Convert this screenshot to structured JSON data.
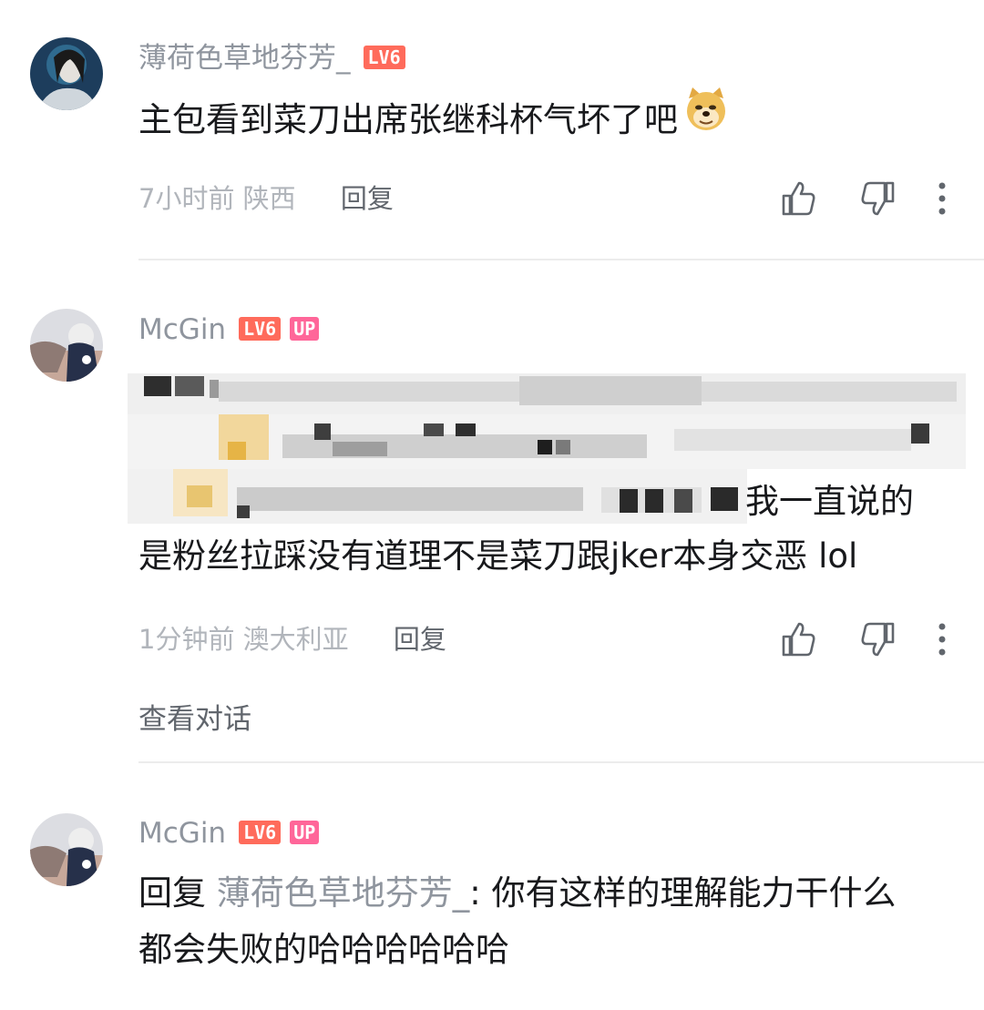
{
  "comments": [
    {
      "username": "薄荷色草地芬芳_",
      "level": "LV6",
      "text": "主包看到菜刀出席张继科杯气坏了吧",
      "emoji": "doge-emoji",
      "time": "7小时前",
      "location": "陕西",
      "reply_label": "回复"
    },
    {
      "username": "McGin",
      "level": "LV6",
      "up_badge": "UP",
      "text_visible_line1": "我一直说的",
      "text_visible_line2": "是粉丝拉踩没有道理不是菜刀跟jker本身交恶 lol",
      "time": "1分钟前",
      "location": "澳大利亚",
      "reply_label": "回复",
      "view_conversation": "查看对话"
    },
    {
      "username": "McGin",
      "level": "LV6",
      "up_badge": "UP",
      "reply_prefix": "回复",
      "mention": "薄荷色草地芬芳_",
      "text_line1": ": 你有这样的理解能力干什么",
      "text_line2": "都会失败的哈哈哈哈哈哈"
    }
  ],
  "icons": [
    "thumbs-up-icon",
    "thumbs-down-icon",
    "more-icon"
  ],
  "colors": {
    "level_badge": "#ff6b5b",
    "up_badge": "#ff6699",
    "meta": "#b1b5bb"
  }
}
